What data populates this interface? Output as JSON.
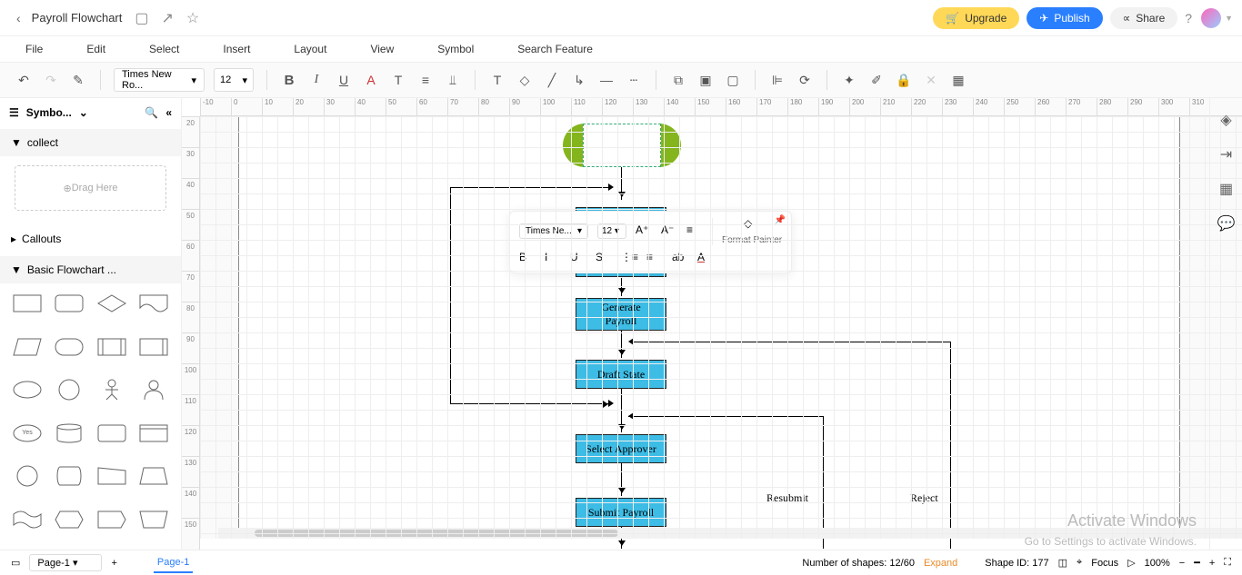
{
  "header": {
    "title": "Payroll Flowchart",
    "upgrade": "Upgrade",
    "publish": "Publish",
    "share": "Share"
  },
  "menu": [
    "File",
    "Edit",
    "Select",
    "Insert",
    "Layout",
    "View",
    "Symbol",
    "Search Feature"
  ],
  "toolbar": {
    "font": "Times New Ro...",
    "size": "12"
  },
  "sidebar": {
    "title": "Symbo...",
    "collect": "collect",
    "drag": "Drag Here",
    "callouts": "Callouts",
    "basic": "Basic Flowchart ..."
  },
  "ruler_h": [
    "-10",
    "0",
    "10",
    "20",
    "30",
    "40",
    "50",
    "60",
    "70",
    "80",
    "90",
    "100",
    "110",
    "120",
    "130",
    "140",
    "150",
    "160",
    "170",
    "180",
    "190",
    "200",
    "210",
    "220",
    "230",
    "240",
    "250",
    "260",
    "270",
    "280",
    "290",
    "300",
    "310"
  ],
  "ruler_v": [
    "20",
    "30",
    "40",
    "50",
    "60",
    "70",
    "80",
    "90",
    "100",
    "110",
    "120",
    "130",
    "140",
    "150"
  ],
  "float": {
    "font": "Times Ne...",
    "size": "12",
    "format": "Format Painter"
  },
  "nodes": {
    "gen": "Generate\nPayroll",
    "draft": "Draft State",
    "select": "Select Approver",
    "submit": "Submit Payroll",
    "resubmit": "Resubmit",
    "reject": "Reject"
  },
  "status": {
    "page": "Page-1",
    "tab": "Page-1",
    "shapes": "Number of shapes: 12/60",
    "expand": "Expand",
    "shapeid": "Shape ID: 177",
    "focus": "Focus",
    "zoom": "100%"
  },
  "watermark": {
    "l1": "Activate Windows",
    "l2": "Go to Settings to activate Windows."
  }
}
